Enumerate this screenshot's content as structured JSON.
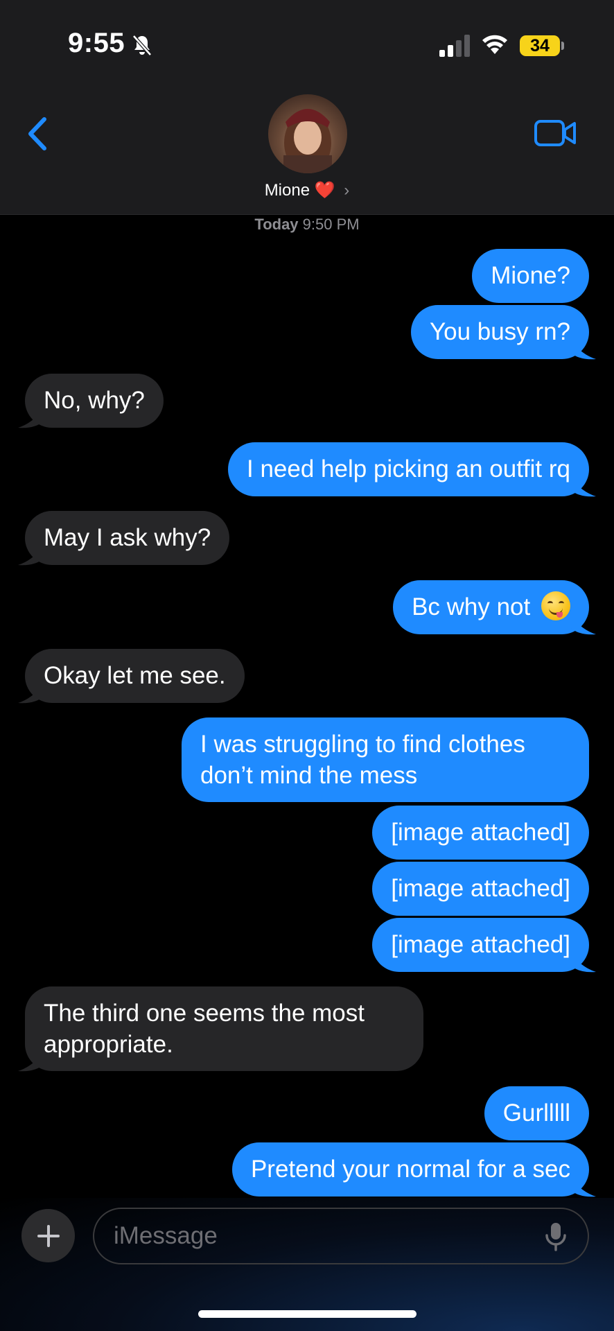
{
  "status_bar": {
    "time": "9:55",
    "battery": "34"
  },
  "contact": {
    "name": "Mione",
    "heart": "❤️",
    "chevron": "›"
  },
  "timestamp": {
    "day": "Today",
    "time": "9:50 PM"
  },
  "messages": [
    {
      "from": "me",
      "text": "Mione?"
    },
    {
      "from": "me",
      "text": "You busy rn?"
    },
    {
      "from": "them",
      "text": "No, why?"
    },
    {
      "from": "me",
      "text": "I need help picking an outfit rq"
    },
    {
      "from": "them",
      "text": "May I ask why?"
    },
    {
      "from": "me",
      "text": "Bc why not"
    },
    {
      "from": "them",
      "text": "Okay let me see."
    },
    {
      "from": "me",
      "text": "I was struggling to find clothes don’t mind the mess"
    },
    {
      "from": "me",
      "text": "[image attached]"
    },
    {
      "from": "me",
      "text": "[image attached]"
    },
    {
      "from": "me",
      "text": "[image attached]"
    },
    {
      "from": "them",
      "text": "The third one seems the most appropriate."
    },
    {
      "from": "me",
      "text": "Gurlllll"
    },
    {
      "from": "me",
      "text": "Pretend your normal for a sec"
    }
  ],
  "composer": {
    "placeholder": "iMessage"
  },
  "colors": {
    "sent": "#1f8bff",
    "received": "#262628",
    "accent": "#1f8bff"
  }
}
